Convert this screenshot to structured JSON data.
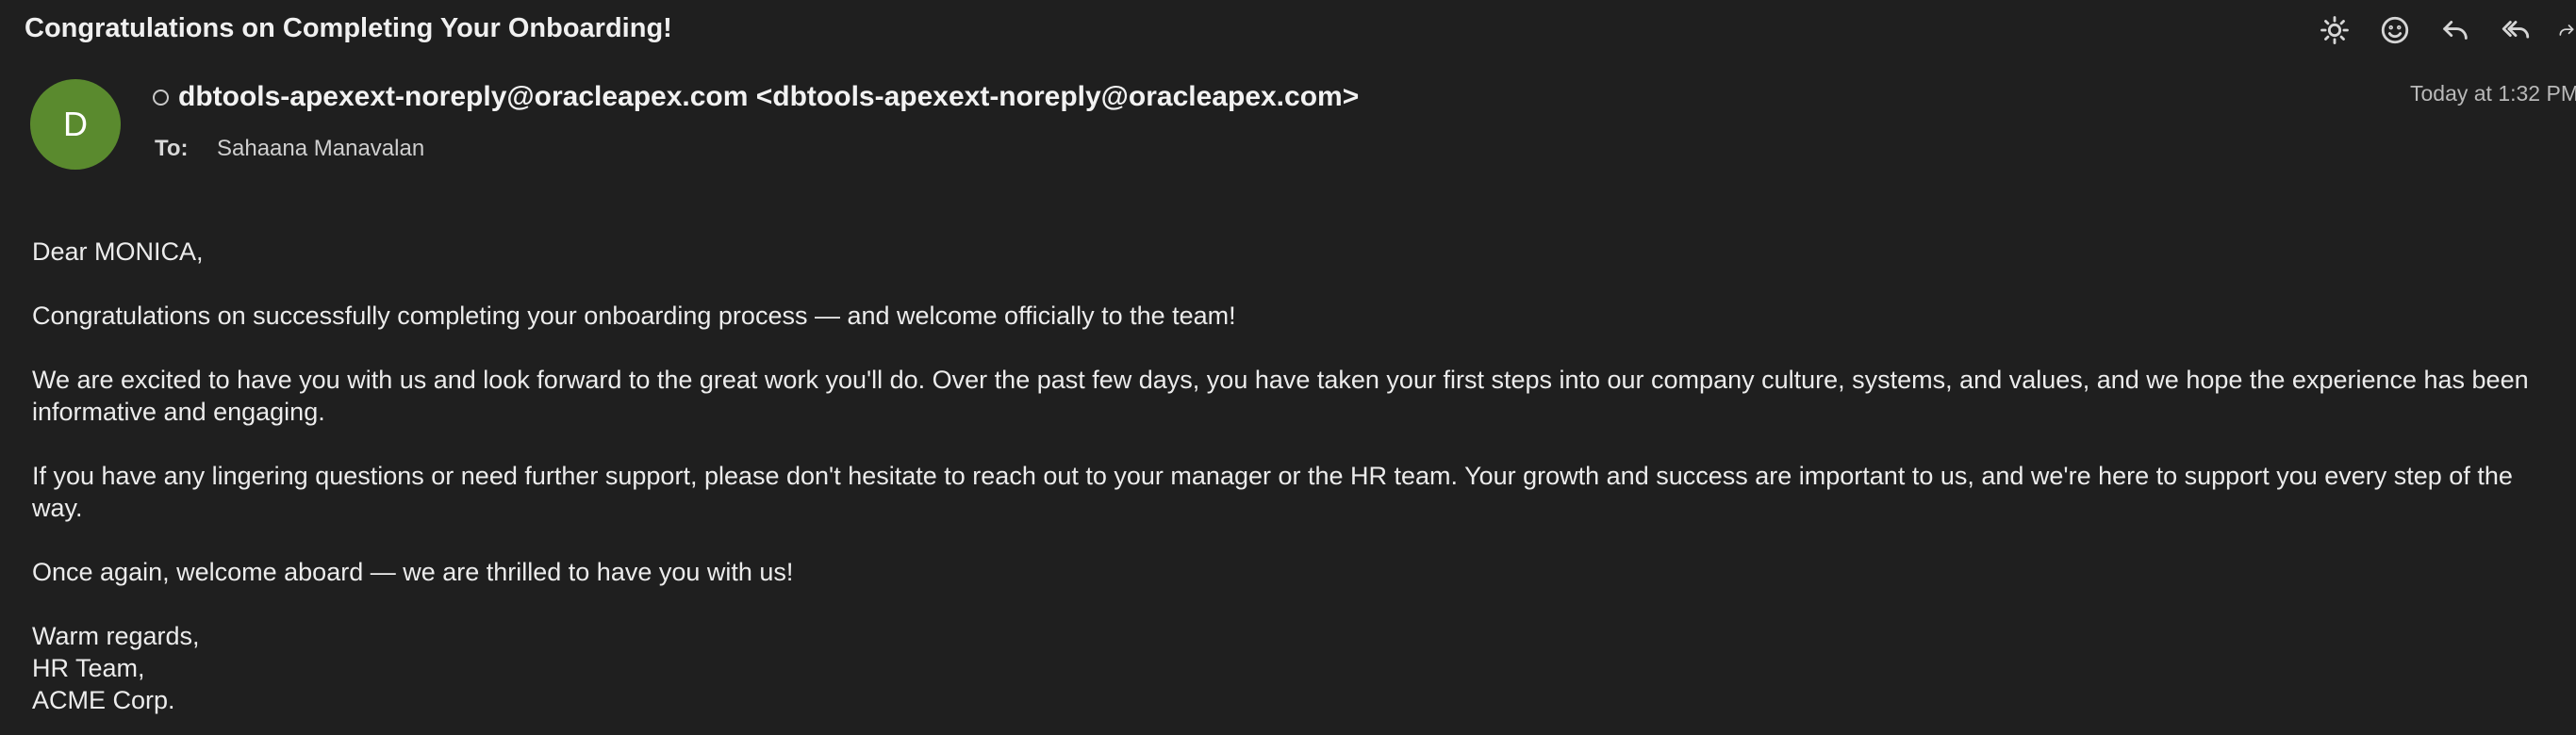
{
  "email": {
    "subject": "Congratulations on Completing Your Onboarding!",
    "avatar_initial": "D",
    "sender": "dbtools-apexext-noreply@oracleapex.com <dbtools-apexext-noreply@oracleapex.com>",
    "to_label": "To:",
    "to_value": "Sahaana Manavalan",
    "date": "Today at 1:32 PM"
  },
  "toolbar": {
    "icons": [
      "sun-icon",
      "smiley-icon",
      "reply-icon",
      "reply-all-icon",
      "forward-icon"
    ]
  },
  "body": {
    "greeting": "Dear MONICA,",
    "paragraphs": [
      "Congratulations on successfully completing your onboarding process — and welcome officially to the team!",
      "We are excited to have you with us and look forward to the great work you'll do. Over the past few days, you have taken your first steps into our company culture, systems, and values, and we hope the experience has been informative and engaging.",
      "If you have any lingering questions or need further support, please don't hesitate to reach out to your manager or the HR team. Your growth and success are important to us, and we're here to support you every step of the way.",
      "Once again, welcome aboard — we are thrilled to have you with us!"
    ],
    "signature": [
      "Warm regards,",
      "HR Team,",
      "ACME Corp."
    ]
  },
  "colors": {
    "background": "#1f1f1f",
    "avatar": "#5a8a2e",
    "text": "#e8e8e8"
  }
}
